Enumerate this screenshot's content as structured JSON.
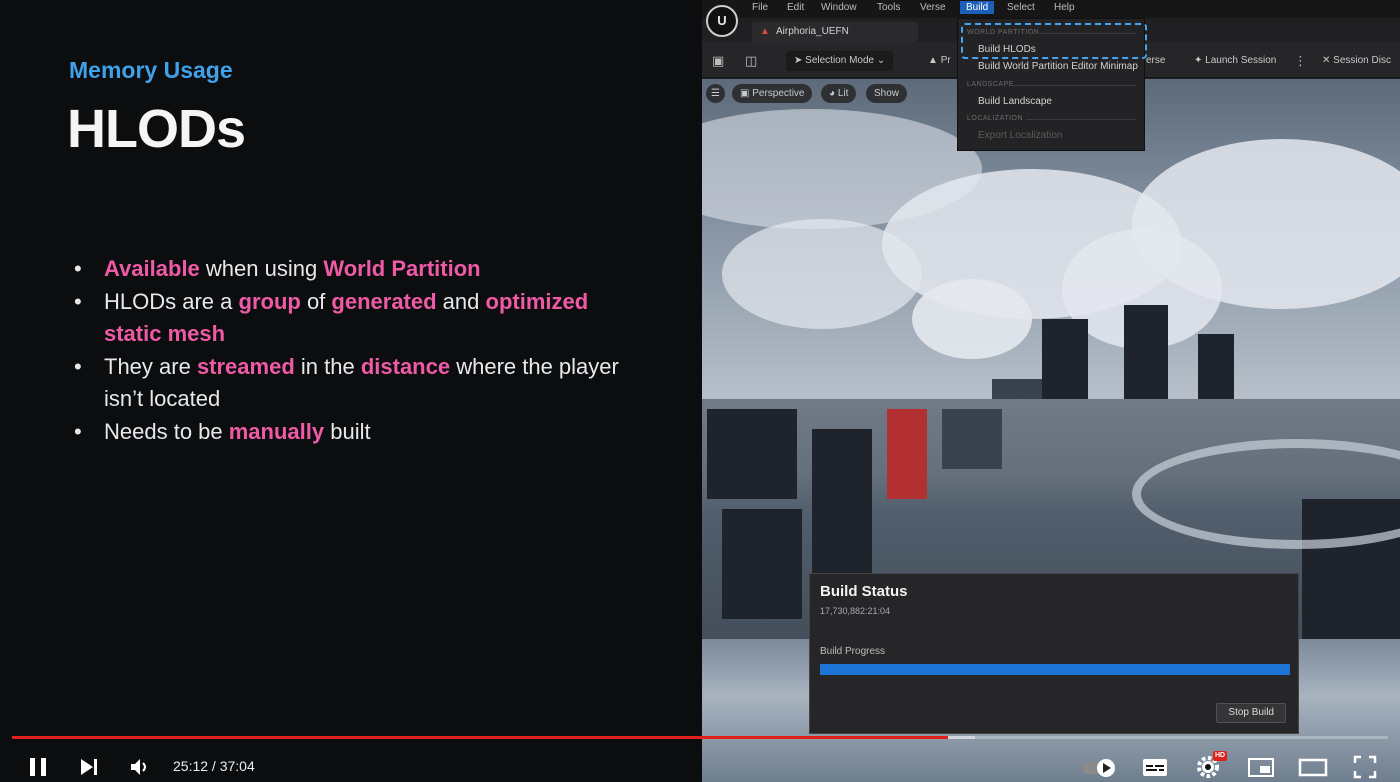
{
  "slide": {
    "subtitle": "Memory Usage",
    "title": "HLODs",
    "bullets": [
      [
        {
          "t": "Available",
          "hl": true
        },
        {
          "t": " when using "
        },
        {
          "t": "World Partition",
          "hl": true
        }
      ],
      [
        {
          "t": "HLODs are a "
        },
        {
          "t": "group",
          "hl": true
        },
        {
          "t": " of "
        },
        {
          "t": "generated",
          "hl": true
        },
        {
          "t": " and "
        },
        {
          "t": "optimized static mesh",
          "hl": true
        }
      ],
      [
        {
          "t": "They are "
        },
        {
          "t": "streamed",
          "hl": true
        },
        {
          "t": " in the "
        },
        {
          "t": "distance",
          "hl": true
        },
        {
          "t": " where the player isn’t located"
        }
      ],
      [
        {
          "t": "Needs to be "
        },
        {
          "t": "manually",
          "hl": true
        },
        {
          "t": " built"
        }
      ]
    ],
    "highlight_color": "#ef5aa6",
    "subtitle_color": "#3fa1e8"
  },
  "editor": {
    "logo": "U",
    "menu": [
      "File",
      "Edit",
      "Window",
      "Tools",
      "Verse",
      "Build",
      "Select",
      "Help"
    ],
    "active_menu": "Build",
    "project_tab": "Airphoria_UEFN",
    "toolbar": {
      "selection_mode": "Selection Mode",
      "project_short": "Pr",
      "verse": "erse",
      "launch_session": "Launch Session",
      "session_disc": "Session Disc"
    },
    "viewport_chips": {
      "perspective": "Perspective",
      "lit": "Lit",
      "show": "Show"
    },
    "build_menu": {
      "section_world": "WORLD PARTITION",
      "build_hlods": "Build HLODs",
      "build_minimap": "Build World Partition Editor Minimap",
      "section_landscape": "LANDSCAPE",
      "build_landscape": "Build Landscape",
      "section_localization": "LOCALIZATION",
      "export_localization": "Export Localization"
    },
    "build_status": {
      "title": "Build Status",
      "timestamp": "17,730,882:21:04",
      "progress_label": "Build Progress",
      "progress_fraction": 1.0,
      "stop_button": "Stop Build"
    }
  },
  "player": {
    "time_display": "25:12 / 37:04",
    "played_fraction": 0.68,
    "buffered_fraction": 0.7,
    "hd_badge": "HD",
    "accent": "#e1201c"
  }
}
